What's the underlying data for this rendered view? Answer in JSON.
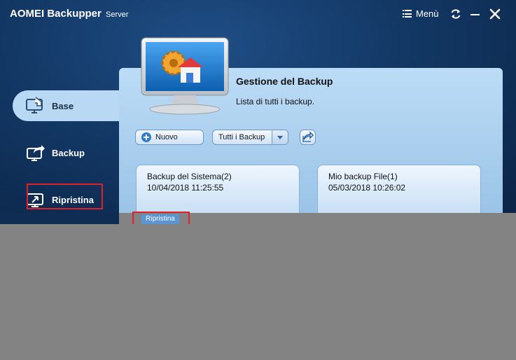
{
  "app": {
    "title": "AOMEI Backupper",
    "edition": "Server",
    "menu_label": "Menù",
    "icons": {
      "menu": "hamburger-icon",
      "refresh": "refresh-icon",
      "minimize": "minimize-icon",
      "close": "close-icon"
    }
  },
  "sidebar": {
    "items": [
      {
        "label": "Base",
        "icon": "home-monitor-icon",
        "active": true
      },
      {
        "label": "Backup",
        "icon": "backup-icon",
        "active": false
      },
      {
        "label": "Ripristina",
        "icon": "restore-icon",
        "active": false
      }
    ]
  },
  "panel": {
    "title": "Gestione del Backup",
    "subtitle": "Lista di tutti i backup.",
    "toolbar": {
      "new_label": "Nuovo",
      "filter_label": "Tutti i Backup"
    }
  },
  "backups": [
    {
      "name": "Backup del Sistema(2)",
      "date": "10/04/2018 11:25:55"
    },
    {
      "name": "Mio backup File(1)",
      "date": "05/03/2018 10:26:02"
    }
  ],
  "actions": {
    "restore_label": "Ripristina"
  },
  "colors": {
    "accent_blue": "#2f7bd0",
    "highlight_red": "#e0202a",
    "panel_light": "#bcdcf6",
    "dark_bg": "#133865"
  }
}
